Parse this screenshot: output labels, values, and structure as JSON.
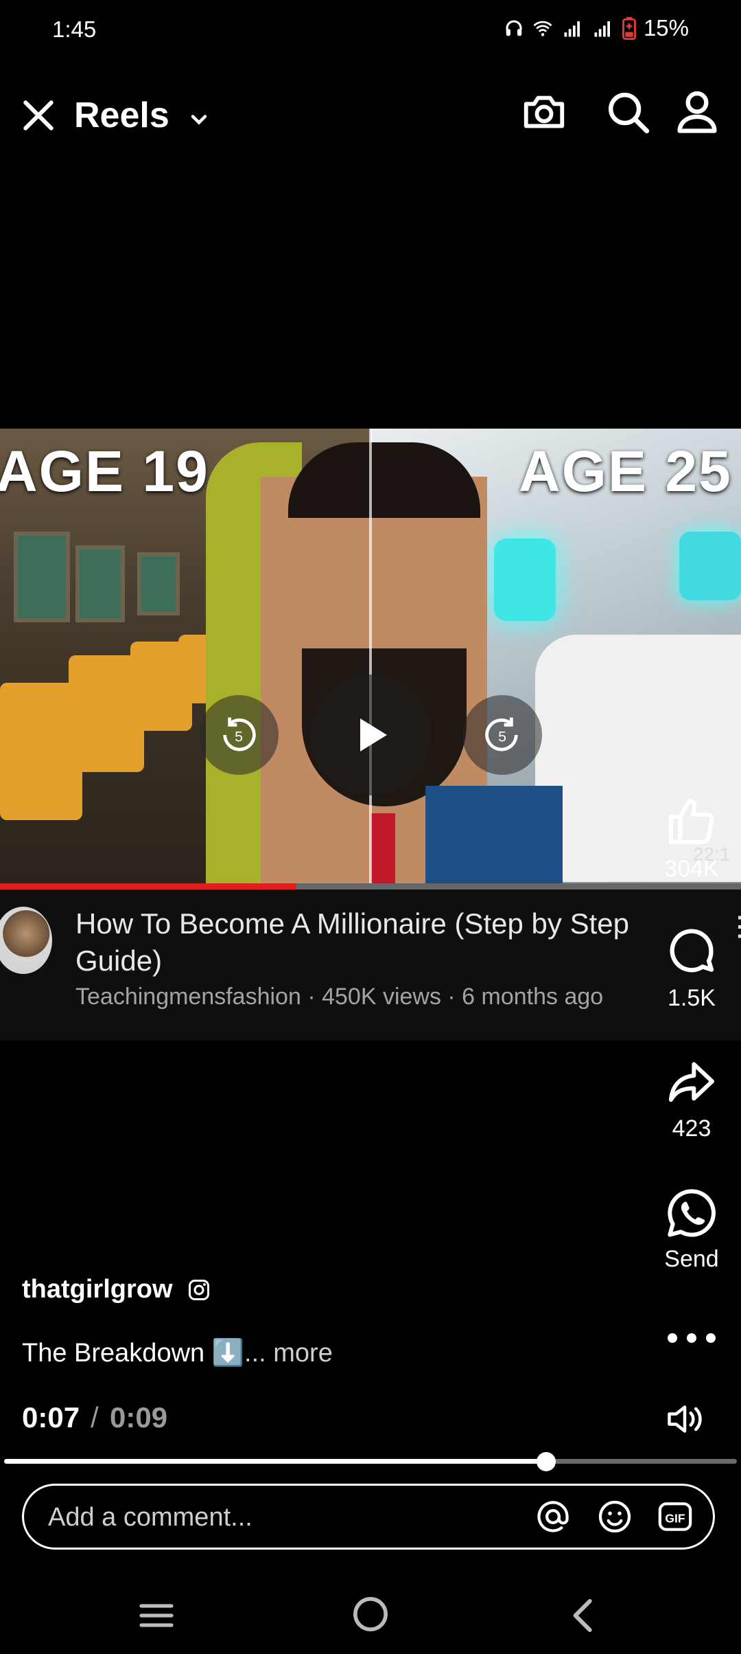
{
  "status_bar": {
    "time": "1:45",
    "battery": "15%"
  },
  "header": {
    "title": "Reels"
  },
  "video": {
    "thumbnail_left_label": "AGE 19",
    "thumbnail_right_label": "AGE 25",
    "replay_seconds": "5",
    "forward_seconds": "5",
    "duration_badge": "22:1",
    "progress_fraction": 0.4,
    "title": "How To Become A Millionaire (Step by Step Guide)",
    "meta": "Teachingmensfashion · 450K views · 6 months ago"
  },
  "actions": {
    "like_count": "304K",
    "comment_count": "1.5K",
    "share_count": "423",
    "send_label": "Send"
  },
  "post": {
    "username": "thatgirlgrow",
    "caption": "The Breakdown ⬇️",
    "caption_more": "... more",
    "time_current": "0:07",
    "time_separator": "/",
    "time_total": "0:09",
    "seek_fraction": 0.74
  },
  "comment": {
    "placeholder": "Add a comment..."
  }
}
